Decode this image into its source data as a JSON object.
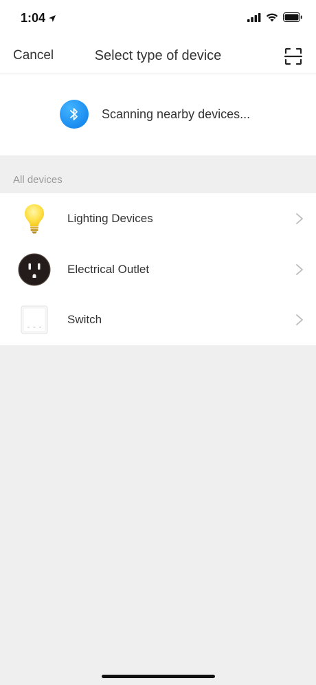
{
  "status_bar": {
    "time": "1:04"
  },
  "nav": {
    "cancel_label": "Cancel",
    "title": "Select type of device"
  },
  "scan": {
    "text": "Scanning nearby devices..."
  },
  "section": {
    "header": "All devices"
  },
  "devices": [
    {
      "label": "Lighting Devices",
      "icon": "light-bulb-icon"
    },
    {
      "label": "Electrical Outlet",
      "icon": "outlet-icon"
    },
    {
      "label": "Switch",
      "icon": "switch-icon"
    }
  ],
  "colors": {
    "accent_blue": "#1a8cf0",
    "background": "#efefef",
    "text_primary": "#333333",
    "text_secondary": "#999999"
  }
}
